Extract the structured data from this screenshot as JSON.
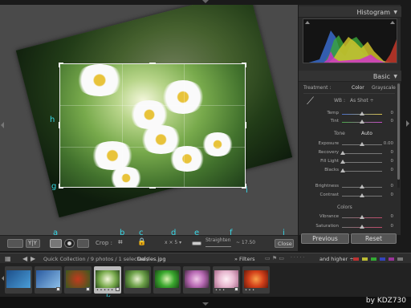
{
  "callouts": {
    "a": "a",
    "b": "b",
    "c": "c",
    "d": "d",
    "e": "e",
    "f": "f",
    "g": "g",
    "h": "h",
    "i": "i",
    "j": "j",
    "k": "k"
  },
  "toolbar": {
    "crop_label": "Crop :",
    "aspect_label": "x × 5 ▾",
    "straighten_label": "Straighten",
    "angle_value": "~ 17.50",
    "close_label": "Close"
  },
  "histogram": {
    "title": "Histogram"
  },
  "basic": {
    "title": "Basic",
    "treatment_label": "Treatment :",
    "treatment_color": "Color",
    "treatment_grayscale": "Grayscale",
    "wb_label": "WB :",
    "wb_value": "As Shot ÷",
    "temp_label": "Temp",
    "temp_value": "0",
    "tint_label": "Tint",
    "tint_value": "0",
    "tone_label": "Tone",
    "auto_label": "Auto",
    "tone_sliders": [
      {
        "label": "Exposure",
        "value": "0.00"
      },
      {
        "label": "Recovery",
        "value": "0"
      },
      {
        "label": "Fill Light",
        "value": "0"
      },
      {
        "label": "Blacks",
        "value": "0"
      }
    ],
    "tone_sliders2": [
      {
        "label": "Brightness",
        "value": "0"
      },
      {
        "label": "Contrast",
        "value": "0"
      }
    ],
    "colors_label": "Colors",
    "color_sliders": [
      {
        "label": "Vibrance",
        "value": "0"
      },
      {
        "label": "Saturation",
        "value": "0"
      }
    ]
  },
  "buttons": {
    "previous": "Previous",
    "reset": "Reset"
  },
  "filmstrip": {
    "path": "Quick Collection / 9 photos / 1 selected /",
    "filename": "Daisies.jpg",
    "filters_label": "Filters",
    "rating_filter": "and higher ÷",
    "thumbs": [
      {
        "dots": "",
        "color": "#2d6fae"
      },
      {
        "dots": "",
        "color": "#3a6fb5"
      },
      {
        "dots": "",
        "color": "#7a2f1e"
      },
      {
        "dots": "• • • • •",
        "color": "#9ecb6e",
        "selected": true
      },
      {
        "dots": "",
        "color": "#6ea24a"
      },
      {
        "dots": "",
        "color": "#3aa82e"
      },
      {
        "dots": "",
        "color": "#b86ab4"
      },
      {
        "dots": "• • •",
        "color": "#e7b7cf"
      },
      {
        "dots": "• • •",
        "color": "#d2401a"
      }
    ]
  },
  "watermark": "by KDZ730",
  "colors": {
    "callout": "#39d9e8"
  }
}
